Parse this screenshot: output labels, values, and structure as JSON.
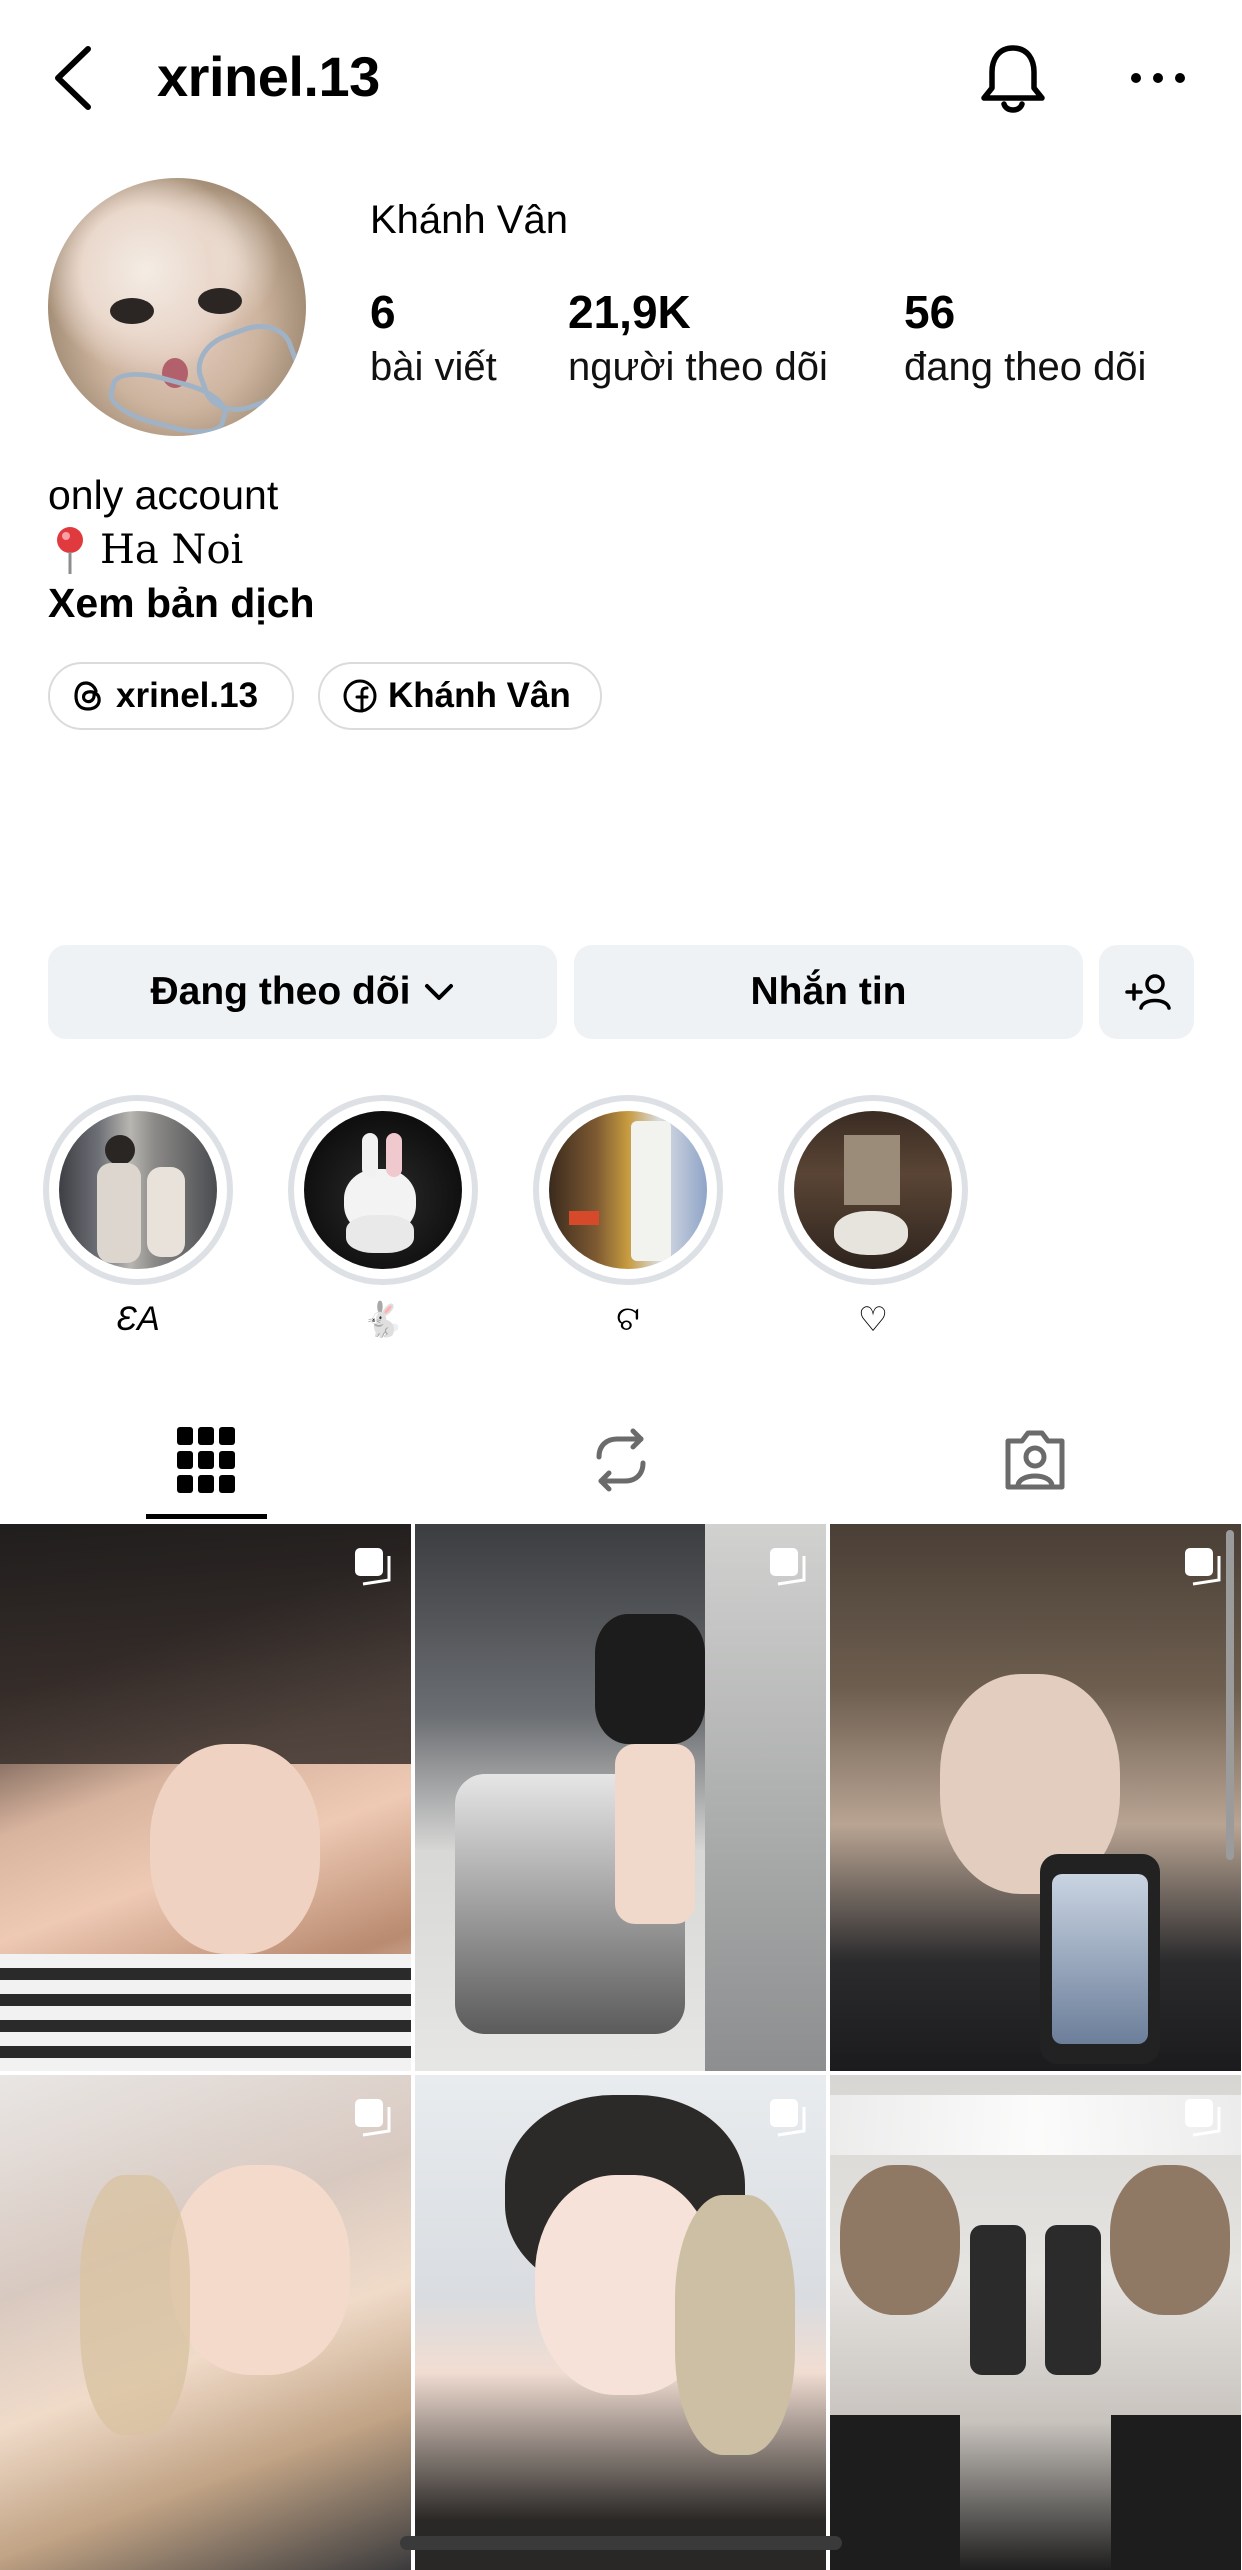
{
  "header": {
    "username": "xrinel.13",
    "back_icon": "chevron-left-icon",
    "bell_icon": "bell-icon",
    "more_icon": "more-horizontal-icon"
  },
  "profile": {
    "display_name": "Khánh Vân",
    "stats": [
      {
        "value": "6",
        "label": "bài viết"
      },
      {
        "value": "21,9K",
        "label": "người theo dõi"
      },
      {
        "value": "56",
        "label": "đang theo dõi"
      }
    ],
    "bio": {
      "line1": "only account",
      "line2": "Ha Noi",
      "translate": "Xem bản dịch"
    },
    "links": [
      {
        "icon": "threads-icon",
        "label": "xrinel.13"
      },
      {
        "icon": "facebook-icon",
        "label": "Khánh Vân"
      }
    ]
  },
  "actions": {
    "following_label": "Đang theo dõi",
    "message_label": "Nhắn tin",
    "add_user_icon": "add-user-icon"
  },
  "highlights": [
    {
      "label": "ƐA"
    },
    {
      "label": "🐇"
    },
    {
      "label": "ଟ"
    },
    {
      "label": "♡"
    }
  ],
  "tabs": [
    {
      "name": "grid",
      "icon": "grid-icon",
      "active": true
    },
    {
      "name": "reposts",
      "icon": "repost-icon",
      "active": false
    },
    {
      "name": "tagged",
      "icon": "tagged-icon",
      "active": false
    }
  ],
  "colors": {
    "button_bg": "#eff2f5",
    "highlight_ring": "#dde0e4",
    "chip_border": "#dbdbdb"
  }
}
